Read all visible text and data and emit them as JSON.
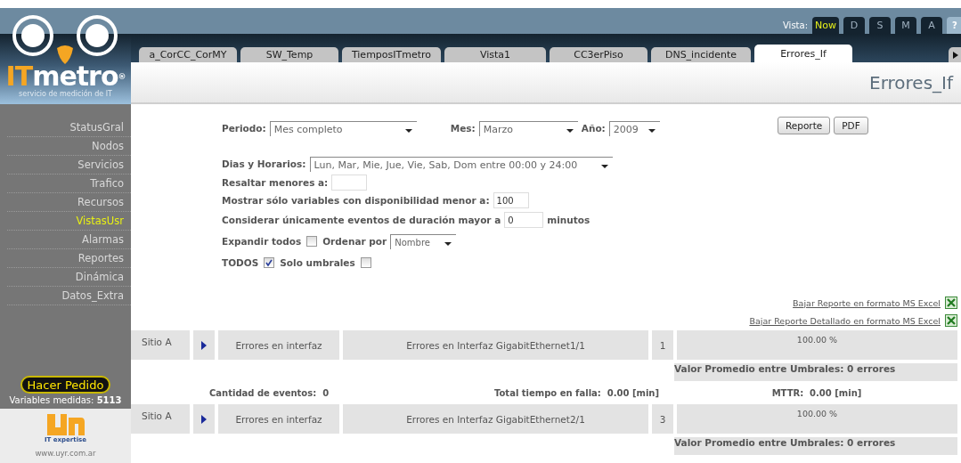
{
  "logo": {
    "prefix": "IT",
    "name": "metro",
    "mark": "®",
    "tagline": "servicio de medición de IT"
  },
  "view_selector": {
    "label": "Vista:",
    "options": [
      {
        "label": "Now",
        "selected": true
      },
      {
        "label": "D",
        "selected": false
      },
      {
        "label": "S",
        "selected": false
      },
      {
        "label": "M",
        "selected": false
      },
      {
        "label": "A",
        "selected": false
      }
    ],
    "help": "?"
  },
  "tabs": [
    {
      "label": "a_CorCC_CorMY",
      "selected": false
    },
    {
      "label": "SW_Temp",
      "selected": false
    },
    {
      "label": "TiemposITmetro",
      "selected": false
    },
    {
      "label": "Vista1",
      "selected": false
    },
    {
      "label": "CC3erPiso",
      "selected": false
    },
    {
      "label": "DNS_incidente",
      "selected": false
    },
    {
      "label": "Errores_If",
      "selected": true
    }
  ],
  "page_title": "Errores_If",
  "sidebar": {
    "items": [
      {
        "label": "StatusGral",
        "selected": false
      },
      {
        "label": "Nodos",
        "selected": false
      },
      {
        "label": "Servicios",
        "selected": false
      },
      {
        "label": "Trafico",
        "selected": false
      },
      {
        "label": "Recursos",
        "selected": false
      },
      {
        "label": "VistasUsr",
        "selected": true
      },
      {
        "label": "Alarmas",
        "selected": false
      },
      {
        "label": "Reportes",
        "selected": false
      },
      {
        "label": "Dinámica",
        "selected": false
      },
      {
        "label": "Datos_Extra",
        "selected": false
      }
    ],
    "order_button": "Hacer Pedido",
    "variables_label": "Variables medidas:",
    "variables_count": "5113",
    "partner": {
      "tagline": "IT expertise",
      "url": "www.uyr.com.ar"
    }
  },
  "filters": {
    "period": {
      "label": "Periodo:",
      "value": "Mes completo"
    },
    "month": {
      "label": "Mes:",
      "value": "Marzo"
    },
    "year": {
      "label": "Año:",
      "value": "2009"
    },
    "schedule": {
      "label": "Dias y Horarios:",
      "value": "Lun, Mar, Mie, Jue, Vie, Sab, Dom entre 00:00 y 24:00"
    },
    "highlight": {
      "label": "Resaltar menores a:"
    },
    "availability": {
      "label": "Mostrar sólo variables con disponibilidad menor a:",
      "value": "100"
    },
    "duration": {
      "label": "Considerar únicamente eventos de duración mayor a",
      "value": "0",
      "unit": "minutos"
    },
    "expand_all": {
      "label": "Expandir todos",
      "checked": false
    },
    "sort": {
      "label": "Ordenar por",
      "value": "Nombre"
    },
    "all": {
      "label": "TODOS",
      "checked": true
    },
    "thresholds_only": {
      "label": "Solo umbrales",
      "checked": false
    }
  },
  "buttons": [
    "Reporte",
    "PDF"
  ],
  "downloads": [
    "Bajar Reporte en formato MS Excel",
    "Bajar Reporte Detallado en formato MS Excel"
  ],
  "results": [
    {
      "site": "Sitio A",
      "variable_type": "Errores en interfaz",
      "variable": "Errores en Interfaz GigabitEthernet1/1",
      "count": "1",
      "availability": "100.00 %",
      "average": "Valor Promedio entre Umbrales: 0 errores",
      "summary": {
        "events": "Cantidad de eventos:  0",
        "downtime": "Total tiempo en falla:  0.00 [min]",
        "mttr": "MTTR:  0.00 [min]"
      }
    },
    {
      "site": "Sitio A",
      "variable_type": "Errores en interfaz",
      "variable": "Errores en Interfaz GigabitEthernet2/1",
      "count": "3",
      "availability": "100.00 %",
      "average": "Valor Promedio entre Umbrales: 0 errores"
    }
  ]
}
